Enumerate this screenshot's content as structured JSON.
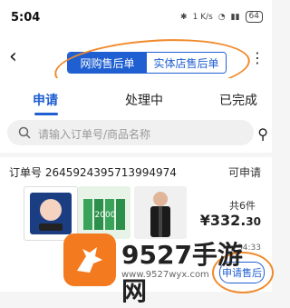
{
  "status_bar": {
    "time": "5:04",
    "net": "1 K/s",
    "battery": "64"
  },
  "header": {
    "segments": [
      "网购售后单",
      "实体店售后单"
    ]
  },
  "tabs": [
    "申请",
    "处理中",
    "已完成"
  ],
  "search": {
    "placeholder": "请输入订单号/商品名称"
  },
  "order": {
    "order_no": "订单号 2645924395713994974",
    "status": "可申请",
    "count": "共6件",
    "price_main": "¥332.",
    "price_dec": "30",
    "time_partial": "34:33",
    "apply_button": "申请售后"
  },
  "watermark": {
    "title": "9527手游网",
    "url": "www.9527wyx.com"
  },
  "colors": {
    "accent": "#1f5fd1",
    "annotation": "#f08a2c",
    "watermark": "#f47a20"
  }
}
